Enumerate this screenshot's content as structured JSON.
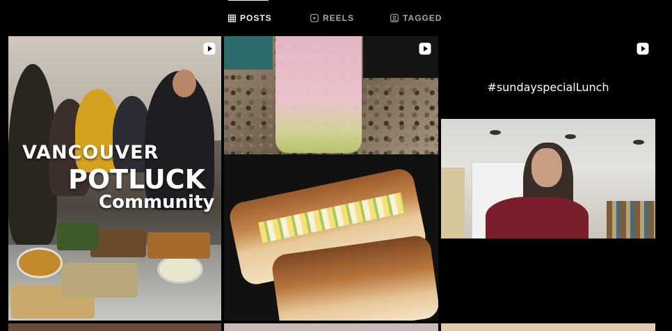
{
  "tabs": [
    {
      "label": "POSTS",
      "icon": "grid-icon",
      "active": true
    },
    {
      "label": "REELS",
      "icon": "reels-icon",
      "active": false
    },
    {
      "label": "TAGGED",
      "icon": "tagged-icon",
      "active": false
    }
  ],
  "posts": [
    {
      "type": "reel",
      "overlay_text": [
        "VANCOUVER",
        "POTLUCK",
        "Community"
      ]
    },
    {
      "type": "reel"
    },
    {
      "type": "reel",
      "caption": "#sundayspecialLunch"
    }
  ]
}
